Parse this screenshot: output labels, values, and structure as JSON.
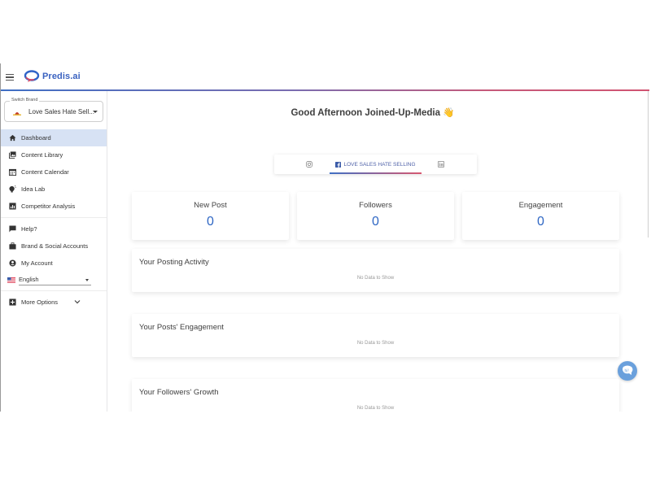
{
  "header": {
    "logo_text": "Predis.ai",
    "brand_color": "#3a62c0",
    "accent_gradient": [
      "#3f6fc4",
      "#d05472"
    ]
  },
  "sidebar": {
    "switch_brand": {
      "legend": "Switch Brand",
      "selected": "Love Sales Hate Sell..."
    },
    "items": [
      {
        "label": "Dashboard",
        "icon": "home-icon",
        "active": true
      },
      {
        "label": "Content Library",
        "icon": "image-library-icon"
      },
      {
        "label": "Content Calendar",
        "icon": "calendar-icon"
      },
      {
        "label": "Idea Lab",
        "icon": "lightbulb-icon"
      },
      {
        "label": "Competitor Analysis",
        "icon": "bar-chart-icon"
      }
    ],
    "secondary_items": [
      {
        "label": "Help?",
        "icon": "chat-bubble-icon"
      },
      {
        "label": "Brand & Social Accounts",
        "icon": "briefcase-icon"
      },
      {
        "label": "My Account",
        "icon": "account-circle-icon"
      }
    ],
    "language": {
      "selected": "English",
      "icon": "us-flag-icon"
    },
    "more_options": {
      "label": "More Options"
    }
  },
  "main": {
    "greeting": "Good Afternoon Joined-Up-Media 👋",
    "tabs": [
      {
        "label": "",
        "icon": "instagram-icon"
      },
      {
        "label": "LOVE SALES HATE SELLING",
        "icon": "facebook-icon",
        "active": true
      },
      {
        "label": "",
        "icon": "linkedin-icon"
      }
    ],
    "stats": [
      {
        "label": "New Post",
        "value": "0"
      },
      {
        "label": "Followers",
        "value": "0"
      },
      {
        "label": "Engagement",
        "value": "0"
      }
    ],
    "panels": [
      {
        "title": "Your Posting Activity",
        "empty_text": "No Data to Show"
      },
      {
        "title": "Your Posts' Engagement",
        "empty_text": "No Data to Show"
      },
      {
        "title": "Your Followers' Growth",
        "empty_text": "No Data to Show"
      }
    ]
  }
}
